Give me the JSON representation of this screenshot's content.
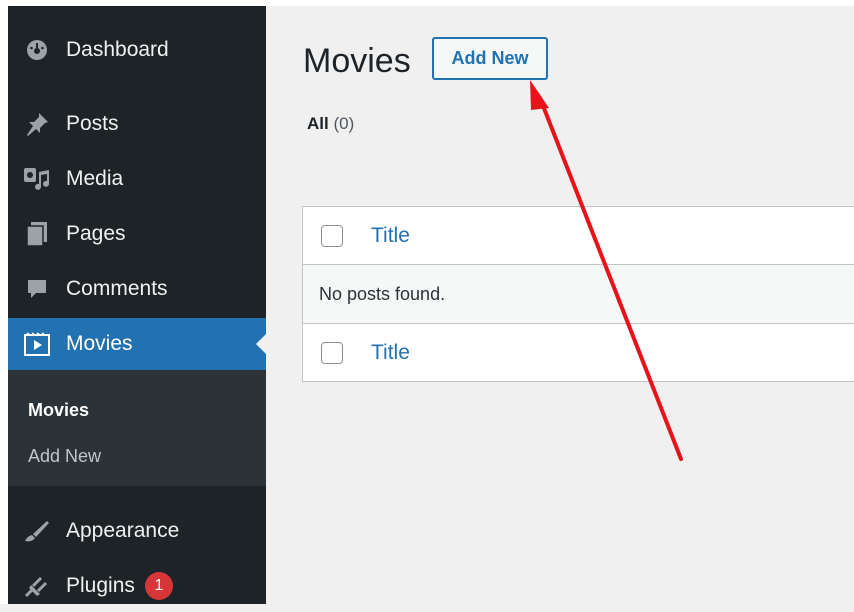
{
  "sidebar": {
    "items": [
      {
        "label": "Dashboard",
        "icon": "dashboard-icon"
      },
      {
        "label": "Posts",
        "icon": "pin-icon"
      },
      {
        "label": "Media",
        "icon": "media-icon"
      },
      {
        "label": "Pages",
        "icon": "pages-icon"
      },
      {
        "label": "Comments",
        "icon": "comment-icon"
      },
      {
        "label": "Movies",
        "icon": "movie-icon",
        "active": true
      },
      {
        "label": "Appearance",
        "icon": "brush-icon"
      },
      {
        "label": "Plugins",
        "icon": "plug-icon",
        "badge": "1"
      }
    ],
    "submenu": [
      {
        "label": "Movies",
        "current": true
      },
      {
        "label": "Add New"
      }
    ]
  },
  "main": {
    "title": "Movies",
    "add_new_label": "Add New",
    "filters": {
      "all_label": "All",
      "all_count": "(0)"
    },
    "table": {
      "column_title": "Title",
      "empty_message": "No posts found."
    }
  },
  "colors": {
    "sidebar_bg": "#1d2327",
    "active": "#2271b1",
    "badge": "#d63638",
    "annotation_arrow": "#e8121b"
  }
}
